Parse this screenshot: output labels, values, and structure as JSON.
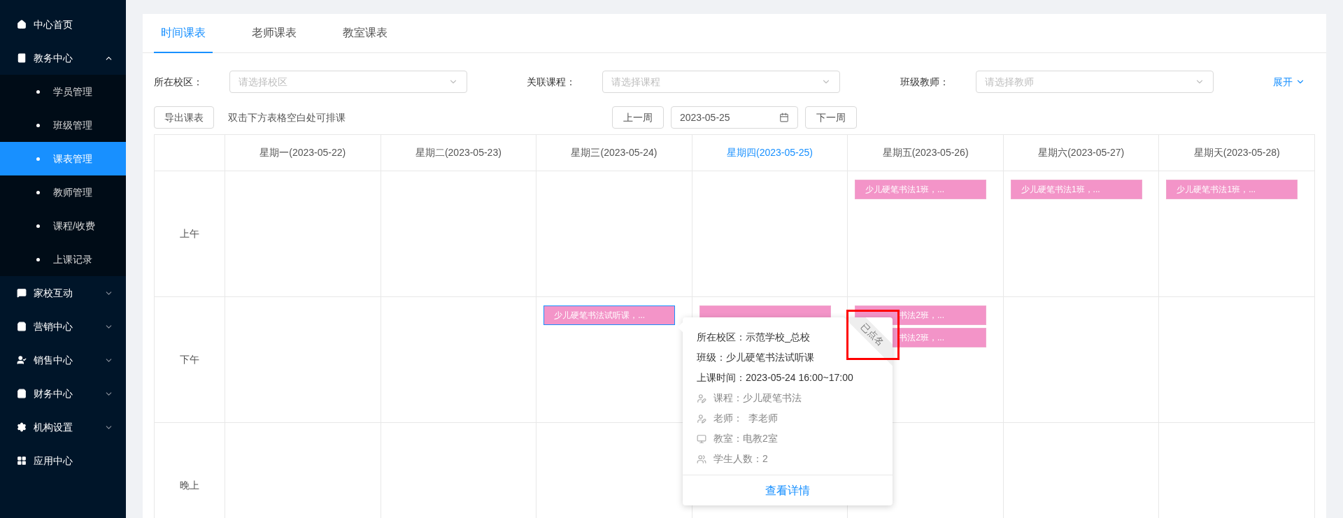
{
  "sidebar": {
    "items": [
      {
        "label": "中心首页"
      },
      {
        "label": "教务中心",
        "expanded": true,
        "children": [
          {
            "label": "学员管理",
            "selected": false
          },
          {
            "label": "班级管理",
            "selected": false
          },
          {
            "label": "课表管理",
            "selected": true
          },
          {
            "label": "教师管理",
            "selected": false
          },
          {
            "label": "课程/收费",
            "selected": false
          },
          {
            "label": "上课记录",
            "selected": false
          }
        ]
      },
      {
        "label": "家校互动",
        "expanded": false
      },
      {
        "label": "营销中心",
        "expanded": false
      },
      {
        "label": "销售中心",
        "expanded": false
      },
      {
        "label": "财务中心",
        "expanded": false
      },
      {
        "label": "机构设置",
        "expanded": false
      },
      {
        "label": "应用中心"
      }
    ]
  },
  "tabs": [
    {
      "label": "时间课表",
      "selected": true
    },
    {
      "label": "老师课表",
      "selected": false
    },
    {
      "label": "教室课表",
      "selected": false
    }
  ],
  "filters": [
    {
      "label": "所在校区：",
      "placeholder": "请选择校区"
    },
    {
      "label": "关联课程：",
      "placeholder": "请选择课程"
    },
    {
      "label": "班级教师：",
      "placeholder": "请选择教师"
    }
  ],
  "expand_link": "展开",
  "toolbar": {
    "export_button": "导出课表",
    "hint": "双击下方表格空白处可排课",
    "prev_week": "上一周",
    "date": "2023-05-25",
    "next_week": "下一周"
  },
  "table": {
    "columns": [
      {
        "label": "星期一(2023-05-22)",
        "today": false
      },
      {
        "label": "星期二(2023-05-23)",
        "today": false
      },
      {
        "label": "星期三(2023-05-24)",
        "today": false
      },
      {
        "label": "星期四(2023-05-25)",
        "today": true
      },
      {
        "label": "星期五(2023-05-26)",
        "today": false
      },
      {
        "label": "星期六(2023-05-27)",
        "today": false
      },
      {
        "label": "星期天(2023-05-28)",
        "today": false
      }
    ],
    "rows": [
      {
        "label": "上午",
        "cells": [
          [],
          [],
          [],
          [],
          [
            {
              "text": "少儿硬笔书法1班，...",
              "selected": false
            }
          ],
          [
            {
              "text": "少儿硬笔书法1班，...",
              "selected": false
            }
          ],
          [
            {
              "text": "少儿硬笔书法1班，...",
              "selected": false
            }
          ]
        ]
      },
      {
        "label": "下午",
        "cells": [
          [],
          [],
          [
            {
              "text": "少儿硬笔书法试听课，...",
              "selected": true
            }
          ],
          [
            {
              "selected": false
            }
          ],
          [
            {
              "text": "书法2班，...",
              "selected": false
            },
            {
              "text": "书法2班，...",
              "selected": false
            }
          ],
          [],
          []
        ]
      },
      {
        "label": "晚上",
        "cells": [
          [],
          [],
          [],
          [],
          [],
          [],
          []
        ]
      }
    ]
  },
  "popover": {
    "badge": "已点名",
    "lines": [
      {
        "kind": "main",
        "text": "所在校区：示范学校_总校"
      },
      {
        "kind": "main",
        "text": "班级：少儿硬笔书法试听课"
      },
      {
        "kind": "main",
        "text": "上课时间：2023-05-24 16:00~17:00"
      },
      {
        "kind": "course",
        "text": "课程：少儿硬笔书法"
      },
      {
        "kind": "teacher",
        "text": "老师：  李老师"
      },
      {
        "kind": "room",
        "text": "教室：电教2室"
      },
      {
        "kind": "students",
        "text": "学生人数：2"
      }
    ],
    "link": "查看详情"
  }
}
